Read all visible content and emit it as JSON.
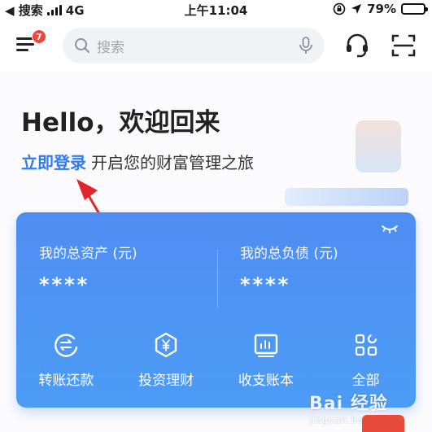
{
  "status_bar": {
    "carrier": "◀ 搜索",
    "network": "4G",
    "time": "上午11:04",
    "battery": "79%",
    "battery_level": 0.79
  },
  "header": {
    "menu_badge": "7",
    "search_placeholder": "搜索"
  },
  "welcome": {
    "greeting": "Hello，欢迎回来",
    "login_link": "立即登录",
    "login_tagline": "开启您的财富管理之旅"
  },
  "asset_card": {
    "total_assets_label": "我的总资产 (元)",
    "total_assets_value": "****",
    "total_liabilities_label": "我的总负债 (元)",
    "total_liabilities_value": "****",
    "actions": [
      {
        "label": "转账还款",
        "icon": "transfer-icon"
      },
      {
        "label": "投资理财",
        "icon": "investment-icon"
      },
      {
        "label": "收支账本",
        "icon": "ledger-icon"
      },
      {
        "label": "全部",
        "icon": "all-grid-icon"
      }
    ]
  },
  "watermark": {
    "text": "Bai 经验",
    "sub": "jingyan.baidu.com"
  },
  "colors": {
    "accent": "#2e7bf0",
    "card_top": "#4f8df2",
    "card_bottom": "#4c9cf6",
    "badge": "#f0463b",
    "arrow": "#e0262c"
  }
}
